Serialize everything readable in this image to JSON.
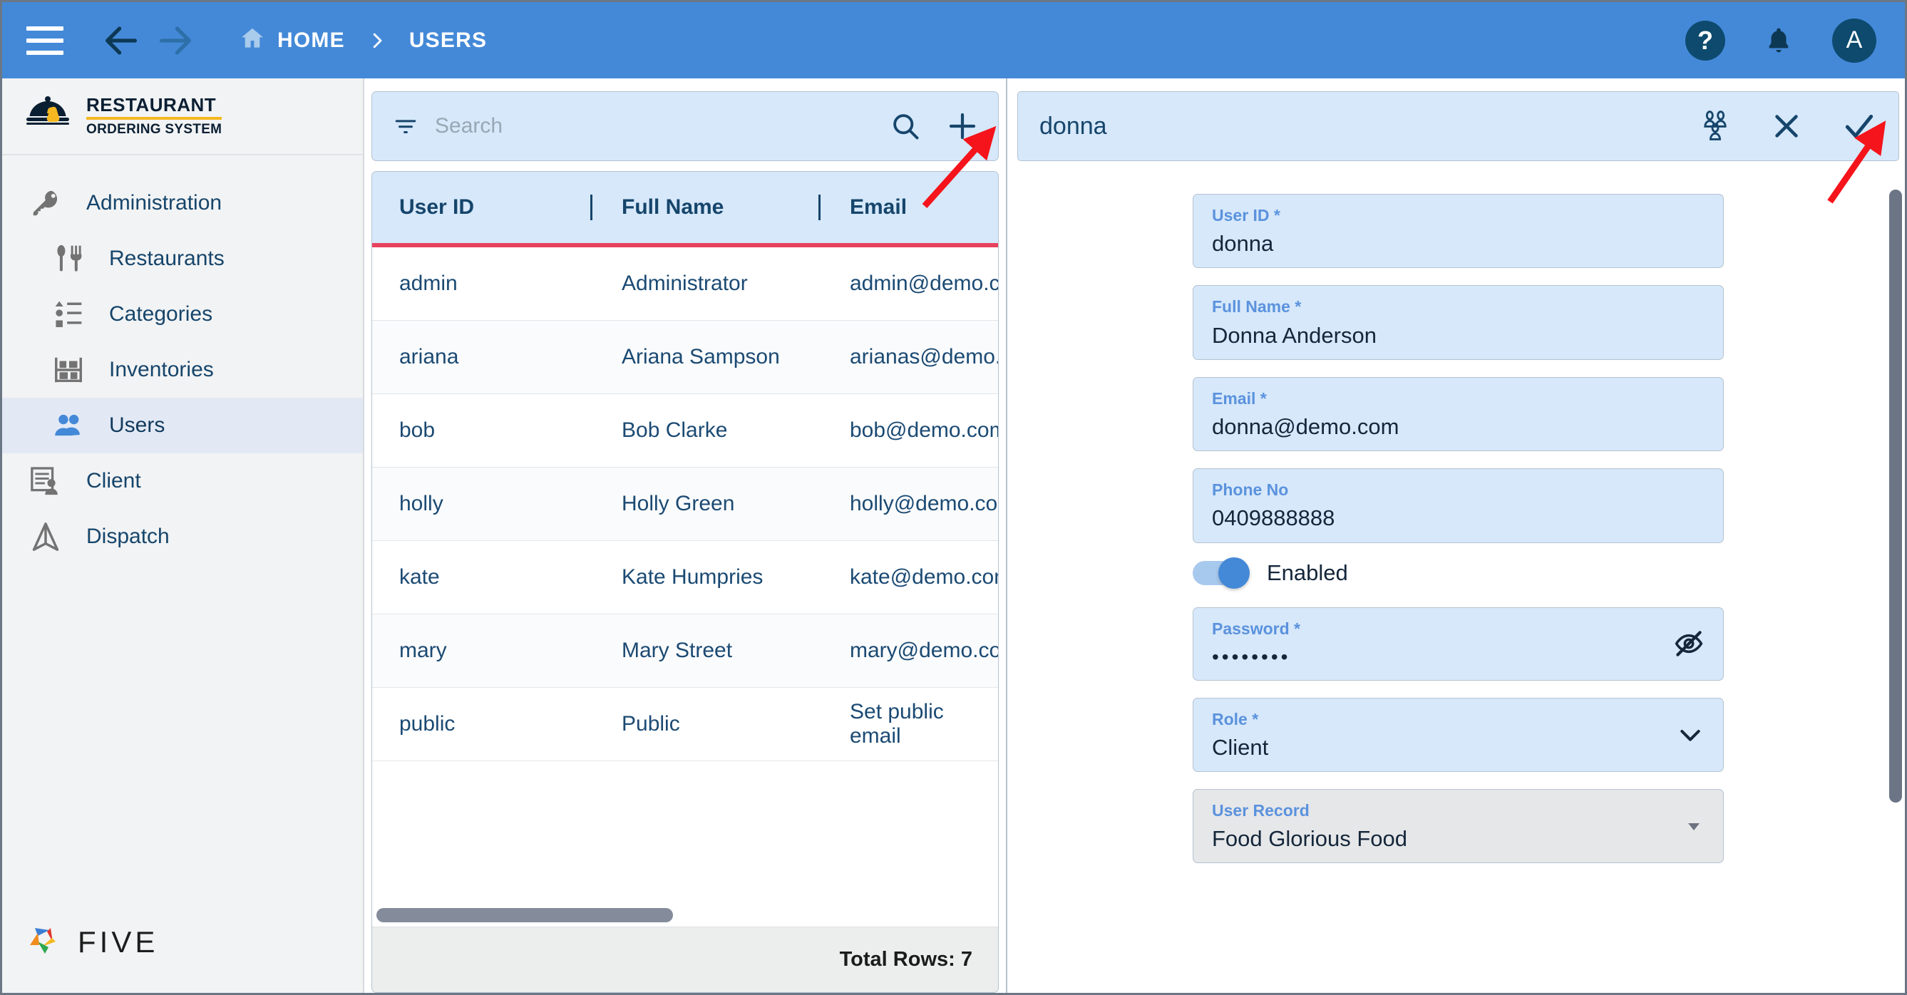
{
  "topbar": {
    "menu_icon": "hamburger-menu-icon",
    "back_icon": "arrow-back-icon",
    "forward_icon": "arrow-forward-icon",
    "home_icon": "home-icon",
    "breadcrumb_home": "HOME",
    "breadcrumb_separator": "chevron-right-icon",
    "breadcrumb_current": "USERS",
    "help_icon": "question-mark-icon",
    "help_label": "?",
    "notifications_icon": "bell-icon",
    "avatar_initial": "A",
    "background_color": "#4489d8",
    "accent_dark": "#0d4a6e"
  },
  "sidebar": {
    "logo": {
      "line1": "RESTAURANT",
      "line2": "ORDERING SYSTEM",
      "icon": "food-cloche-icon",
      "underline_color": "#f5b820"
    },
    "items": [
      {
        "label": "Administration",
        "icon": "key-icon",
        "active": false,
        "indent": false
      },
      {
        "label": "Restaurants",
        "icon": "cutlery-icon",
        "active": false,
        "indent": true
      },
      {
        "label": "Categories",
        "icon": "category-list-icon",
        "active": false,
        "indent": true
      },
      {
        "label": "Inventories",
        "icon": "shelf-icon",
        "active": false,
        "indent": true
      },
      {
        "label": "Users",
        "icon": "people-icon",
        "active": true,
        "indent": true
      },
      {
        "label": "Client",
        "icon": "client-record-icon",
        "active": false,
        "indent": false
      },
      {
        "label": "Dispatch",
        "icon": "dispatch-arrow-icon",
        "active": false,
        "indent": false
      }
    ],
    "footer_logo": "FIVE",
    "active_bg": "#e2e9f5"
  },
  "list_panel": {
    "filter_icon": "filter-icon",
    "search_placeholder": "Search",
    "search_value": "",
    "search_icon": "search-icon",
    "add_icon": "plus-icon",
    "columns": [
      "User ID",
      "Full Name",
      "Email"
    ],
    "rows": [
      {
        "user_id": "admin",
        "full_name": "Administrator",
        "email": "admin@demo.co"
      },
      {
        "user_id": "ariana",
        "full_name": "Ariana Sampson",
        "email": "arianas@demo.c…"
      },
      {
        "user_id": "bob",
        "full_name": "Bob Clarke",
        "email": "bob@demo.com"
      },
      {
        "user_id": "holly",
        "full_name": "Holly Green",
        "email": "holly@demo.com"
      },
      {
        "user_id": "kate",
        "full_name": "Kate Humpries",
        "email": "kate@demo.com"
      },
      {
        "user_id": "mary",
        "full_name": "Mary Street",
        "email": "mary@demo.co"
      },
      {
        "user_id": "public",
        "full_name": "Public",
        "email": "Set public email"
      }
    ],
    "total_rows_label": "Total Rows: 7",
    "header_underline_color": "#e8425f",
    "header_bg": "#d6e8fa"
  },
  "form_panel": {
    "title": "donna",
    "actions": {
      "users_icon": "user-group-icon",
      "close_icon": "close-x-icon",
      "save_icon": "checkmark-icon"
    },
    "fields": [
      {
        "label": "User ID *",
        "value": "donna",
        "type": "text",
        "icon": null,
        "disabled": false
      },
      {
        "label": "Full Name *",
        "value": "Donna Anderson",
        "type": "text",
        "icon": null,
        "disabled": false
      },
      {
        "label": "Email *",
        "value": "donna@demo.com",
        "type": "text",
        "icon": null,
        "disabled": false
      },
      {
        "label": "Phone No",
        "value": "0409888888",
        "type": "text",
        "icon": null,
        "disabled": false
      },
      {
        "label": "Password *",
        "value": "••••••••",
        "type": "password",
        "icon": "eye-off-icon",
        "disabled": false
      },
      {
        "label": "Role *",
        "value": "Client",
        "type": "select",
        "icon": "chevron-down-icon",
        "disabled": false
      },
      {
        "label": "User Record",
        "value": "Food Glorious Food",
        "type": "select",
        "icon": "triangle-down-icon",
        "disabled": true
      }
    ],
    "toggle": {
      "label": "Enabled",
      "on": true,
      "on_color": "#4489d8"
    }
  },
  "annotations": {
    "arrow_color": "#f5141b",
    "arrows": [
      {
        "name": "arrow-pointing-to-add-button"
      },
      {
        "name": "arrow-pointing-to-save-button"
      }
    ]
  }
}
